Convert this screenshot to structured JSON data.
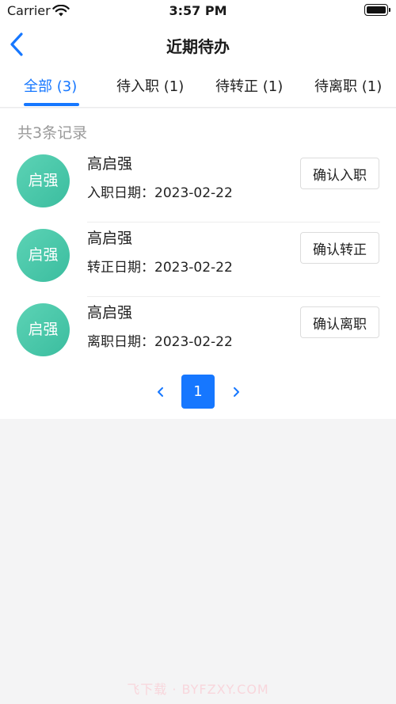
{
  "status_bar": {
    "carrier": "Carrier",
    "time": "3:57 PM"
  },
  "nav": {
    "title": "近期待办"
  },
  "tabs": [
    {
      "label": "全部 (3)",
      "active": true
    },
    {
      "label": "待入职 (1)",
      "active": false
    },
    {
      "label": "待转正 (1)",
      "active": false
    },
    {
      "label": "待离职 (1)",
      "active": false
    }
  ],
  "summary": {
    "count_text": "共3条记录"
  },
  "records": [
    {
      "avatar_text": "启强",
      "name": "高启强",
      "date_text": "入职日期：2023-02-22",
      "action_label": "确认入职"
    },
    {
      "avatar_text": "启强",
      "name": "高启强",
      "date_text": "转正日期：2023-02-22",
      "action_label": "确认转正"
    },
    {
      "avatar_text": "启强",
      "name": "高启强",
      "date_text": "离职日期：2023-02-22",
      "action_label": "确认离职"
    }
  ],
  "pagination": {
    "current_page": "1"
  },
  "watermark": "飞下载 · BYFZXY.COM",
  "colors": {
    "accent": "#1677ff",
    "avatar": "#4cc8a9",
    "muted_text": "#9a9a9a"
  }
}
